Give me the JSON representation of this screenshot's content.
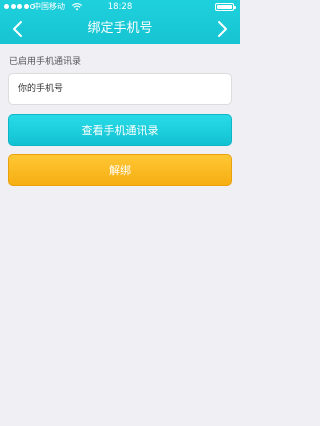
{
  "status_bar": {
    "carrier": "中国移动",
    "time": "18:28",
    "signal_icon": "signal-dots-icon",
    "wifi_icon": "wifi-icon",
    "battery_icon": "battery-icon"
  },
  "nav": {
    "title": "绑定手机号",
    "back_icon": "chevron-left-icon",
    "forward_icon": "chevron-right-icon"
  },
  "content": {
    "section_label": "已启用手机通讯录",
    "phone_placeholder": "你的手机号",
    "view_contacts_label": "查看手机通讯录",
    "unbind_label": "解绑"
  },
  "colors": {
    "header": "#16c4d2",
    "background": "#efeff4",
    "view_button": "#12c2d2",
    "unbind_button": "#f6ae12"
  }
}
